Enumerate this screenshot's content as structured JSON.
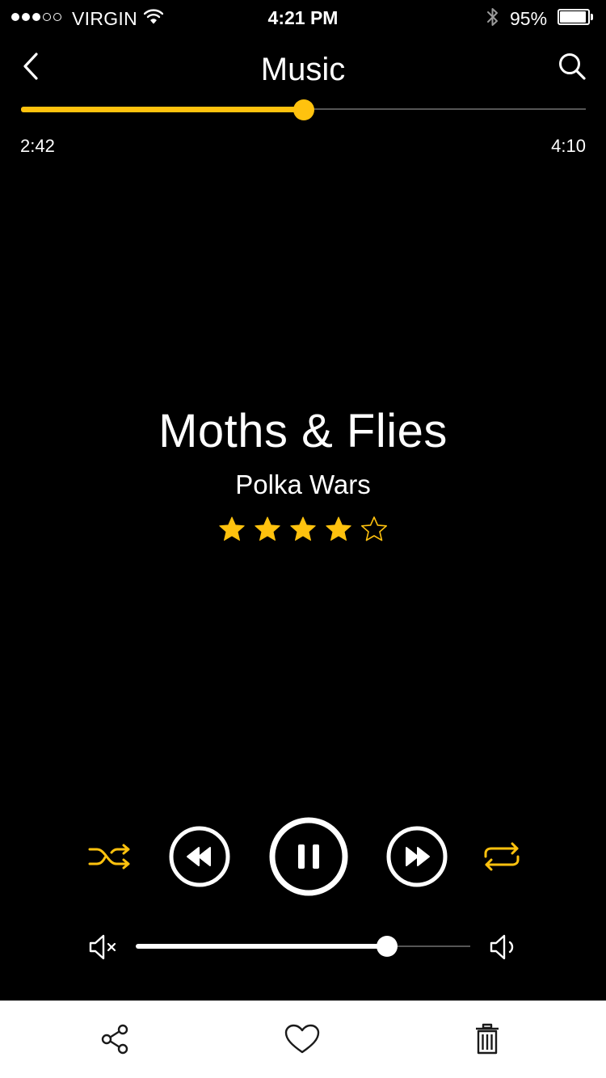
{
  "status_bar": {
    "signal_bars_filled": 3,
    "signal_bars_total": 5,
    "carrier": "VIRGIN",
    "time": "4:21 PM",
    "bluetooth_icon": "bluetooth-icon",
    "battery_percent": "95%",
    "battery_level": 0.95
  },
  "nav": {
    "back_icon": "chevron-left-icon",
    "title": "Music",
    "search_icon": "search-icon"
  },
  "progress": {
    "elapsed": "2:42",
    "total": "4:10",
    "fraction": 0.5
  },
  "track": {
    "title": "Moths & Flies",
    "artist": "Polka Wars",
    "rating": 4,
    "rating_max": 5
  },
  "controls": {
    "shuffle_icon": "shuffle-icon",
    "rewind_icon": "rewind-icon",
    "pause_icon": "pause-icon",
    "fast_forward_icon": "fast-forward-icon",
    "repeat_icon": "repeat-icon",
    "shuffle_active": true,
    "repeat_active": true
  },
  "volume": {
    "mute_icon": "volume-mute-icon",
    "max_icon": "volume-max-icon",
    "level": 0.75
  },
  "toolbar": {
    "share_icon": "share-icon",
    "like_icon": "heart-icon",
    "delete_icon": "trash-icon"
  },
  "colors": {
    "accent": "#FFC20E",
    "background": "#000000",
    "foreground": "#FFFFFF",
    "toolbar_background": "#FFFFFF",
    "toolbar_icon": "#1a1a1a"
  }
}
